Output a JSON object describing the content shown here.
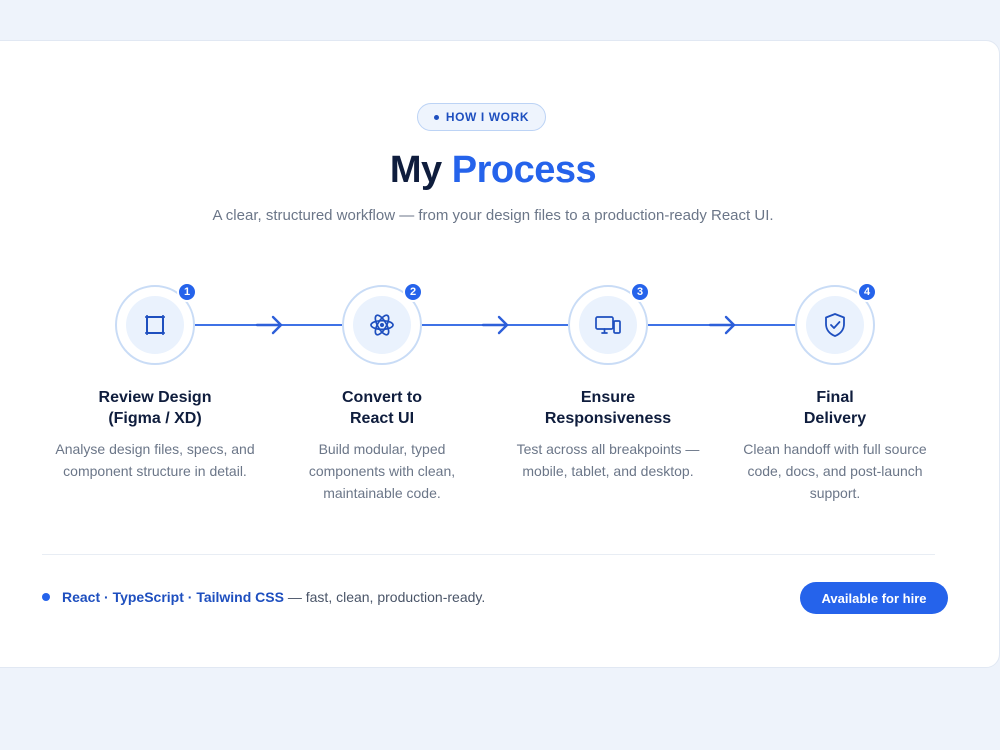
{
  "section": {
    "eyebrow": "HOW I WORK",
    "title_part1": "My",
    "title_part2": "Process",
    "subtitle": "A clear, structured workflow — from your design files to a production-ready React UI."
  },
  "steps": [
    {
      "number": "1",
      "icon": "frame-icon",
      "title": "Review Design\n(Figma / XD)",
      "description": "Analyse design files, specs, and component structure in detail."
    },
    {
      "number": "2",
      "icon": "react-atom-icon",
      "title": "Convert to\nReact UI",
      "description": "Build modular, typed components with clean, maintainable code."
    },
    {
      "number": "3",
      "icon": "devices-icon",
      "title": "Ensure\nResponsiveness",
      "description": "Test across all breakpoints — mobile, tablet, and desktop."
    },
    {
      "number": "4",
      "icon": "shield-check-icon",
      "title": "Final\nDelivery",
      "description": "Clean handoff with full source code, docs, and post-launch support."
    }
  ],
  "footer": {
    "tech": "React · TypeScript · Tailwind CSS",
    "tagline": " — fast, clean, production-ready.",
    "cta_label": "Available for hire"
  },
  "colors": {
    "accent": "#2563eb",
    "heading": "#0f1d3d",
    "muted": "#6b7688"
  }
}
